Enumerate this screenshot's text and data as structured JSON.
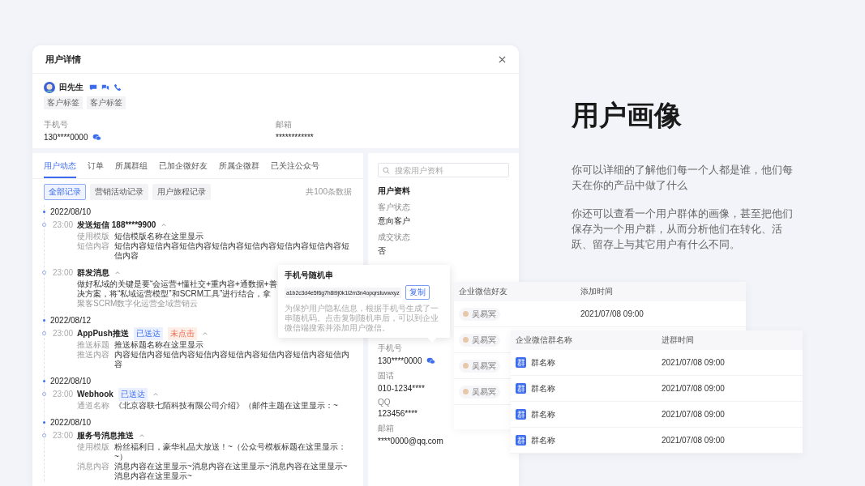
{
  "window": {
    "title": "用户详情"
  },
  "profile": {
    "name": "田先生",
    "tags": [
      "客户标签",
      "客户标签"
    ],
    "fields": [
      {
        "label": "手机号",
        "value": "130****0000",
        "wechat": true
      },
      {
        "label": "邮箱",
        "value": "************",
        "wechat": false
      }
    ]
  },
  "tabs": [
    {
      "label": "用户动态",
      "selected": true
    },
    {
      "label": "订单",
      "selected": false
    },
    {
      "label": "所属群组",
      "selected": false
    },
    {
      "label": "已加企微好友",
      "selected": false
    },
    {
      "label": "所属企微群",
      "selected": false
    },
    {
      "label": "已关注公众号",
      "selected": false
    }
  ],
  "filters": [
    {
      "label": "全部记录",
      "selected": true
    },
    {
      "label": "营销活动记录",
      "selected": false
    },
    {
      "label": "用户旅程记录",
      "selected": false
    }
  ],
  "record_count": "共100条数据",
  "timeline": [
    {
      "date": "2022/08/10",
      "events": [
        {
          "time": "23:00",
          "title": "发送短信 188****9900",
          "expanded": true,
          "details": [
            {
              "label": "使用模版",
              "value": "短信模版名称在这里显示"
            },
            {
              "label": "短信内容",
              "value": "短信内容短信内容短信内容短信内容短信内容短信内容短信内容短信内容"
            }
          ]
        },
        {
          "time": "23:00",
          "title": "群发消息",
          "expanded": true,
          "body": [
            "做好私域的关键是要“会运营+懂社交+重内容+通数据+善",
            "决方案，将“私域运营模型”和SCRM工具”进行结合，拿"
          ],
          "source": "聚客SCRM数字化运营全域营销云"
        }
      ]
    },
    {
      "date": "2022/08/12",
      "events": [
        {
          "time": "23:00",
          "title": "AppPush推送",
          "expanded": true,
          "badges": [
            {
              "text": "已送达",
              "kind": "delivered"
            },
            {
              "text": "未点击",
              "kind": "unclicked"
            }
          ],
          "details": [
            {
              "label": "推送标题",
              "value": "推送标题名称在这里显示"
            },
            {
              "label": "推送内容",
              "value": "内容短信内容短信内容短信内容短信内容短信内容短信内容短信内容"
            }
          ]
        }
      ]
    },
    {
      "date": "2022/08/10",
      "events": [
        {
          "time": "23:00",
          "title": "Webhook",
          "expanded": true,
          "badges": [
            {
              "text": "已送达",
              "kind": "delivered"
            }
          ],
          "details": [
            {
              "label": "通道名称",
              "value": "《北京容联七陌科技有限公司介绍》（邮件主题在这里显示：~"
            }
          ]
        }
      ]
    },
    {
      "date": "2022/08/10",
      "events": [
        {
          "time": "23:00",
          "title": "服务号消息推送",
          "expanded": true,
          "details": [
            {
              "label": "使用模版",
              "value": "粉丝福利日，豪华礼品大放送！~（公众号模板标题在这里显示：~）"
            },
            {
              "label": "消息内容",
              "value": "消息内容在这里显示~消息内容在这里显示~消息内容在这里显示~消息内容在这里显示~"
            }
          ]
        }
      ]
    }
  ],
  "search": {
    "placeholder": "搜索用户资料"
  },
  "user_info": {
    "title": "用户资料",
    "fields": [
      {
        "label": "客户状态",
        "value": "意向客户"
      },
      {
        "label": "成交状态",
        "value": "否"
      }
    ],
    "contact_fields": [
      {
        "label": "手机号",
        "value": "130****0000",
        "wechat": true
      },
      {
        "label": "固话",
        "value": "010-1234****",
        "wechat": false
      },
      {
        "label": "QQ",
        "value": "123456****",
        "wechat": false
      },
      {
        "label": "邮箱",
        "value": "****0000@qq.com",
        "wechat": false
      }
    ]
  },
  "popover": {
    "title": "手机号随机串",
    "code": "a1b2c3d4e5f6g7h8i9j0k1l2m3n4opqrstuvwxyz",
    "button": "复制",
    "note": "为保护用户隐私信息，根据手机号生成了一串随机码。点击复制随机串后，可以到企业微信端搜索并添加用户微信。"
  },
  "friend_table": {
    "columns": [
      "企业微信好友",
      "添加时间"
    ],
    "rows": [
      {
        "contact": "吴易冥",
        "added": "2021/07/08 09:00"
      },
      {
        "contact": "吴易冥"
      },
      {
        "contact": "吴易冥"
      },
      {
        "contact": "吴易冥"
      }
    ]
  },
  "group_table": {
    "columns": [
      "企业微信群名称",
      "进群时间"
    ],
    "rows": [
      {
        "icon": "群",
        "name": "群名称",
        "joined": "2021/07/08 09:00"
      },
      {
        "icon": "群",
        "name": "群名称",
        "joined": "2021/07/08 09:00"
      },
      {
        "icon": "群",
        "name": "群名称",
        "joined": "2021/07/08 09:00"
      },
      {
        "icon": "群",
        "name": "群名称",
        "joined": "2021/07/08 09:00"
      }
    ]
  },
  "feature": {
    "title": "用户画像",
    "paragraphs": [
      "你可以详细的了解他们每一个人都是谁，他们每天在你的产品中做了什么",
      "你还可以查看一个用户群体的画像，甚至把他们保存为一个用户群，从而分析他们在转化、活跃、留存上与其它用户有什么不同。"
    ]
  }
}
